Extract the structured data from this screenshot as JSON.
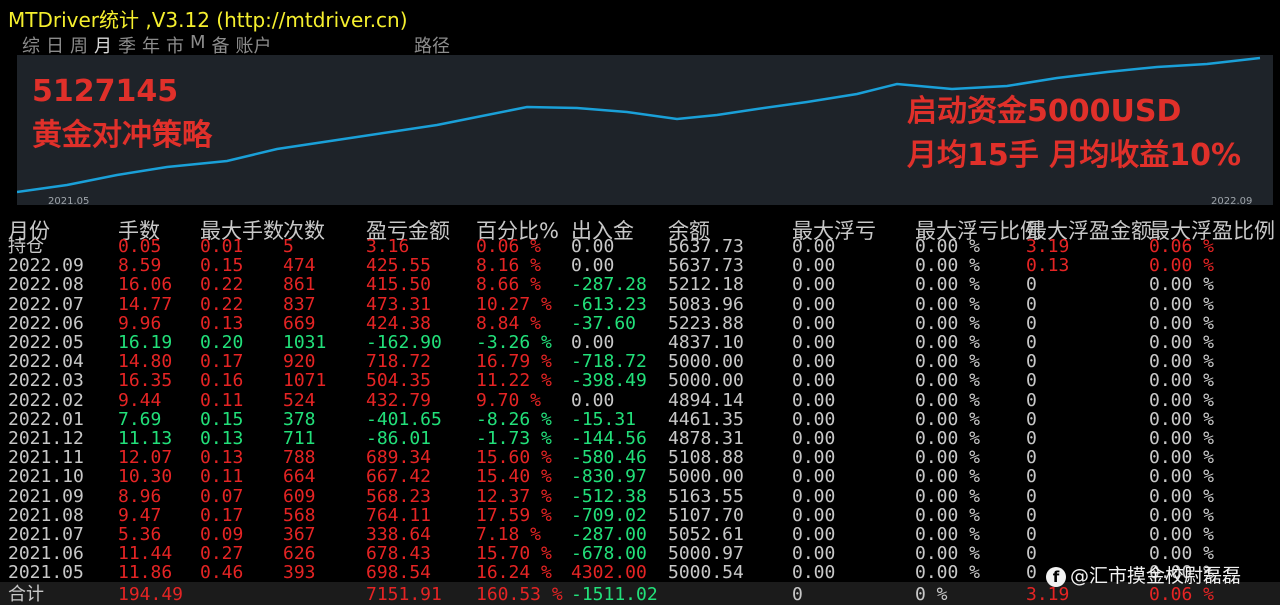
{
  "title": "MTDriver统计 ,V3.12 (http://mtdriver.cn)",
  "tabs": [
    "综",
    "日",
    "周",
    "月",
    "季",
    "年",
    "市",
    "M",
    "备",
    "账户"
  ],
  "active_tab": "月",
  "path_label": "路径",
  "chart": {
    "x_start": "2021.05",
    "x_end": "2022.09",
    "line_color": "#1aa0d8",
    "overlay_left": [
      "5127145",
      "黄金对冲策略"
    ],
    "overlay_right": [
      "启动资金5000USD",
      "月均15手  月均收益10%"
    ]
  },
  "headers": [
    "月份",
    "手数",
    "最大手数",
    "次数",
    "盈亏金额",
    "百分比%",
    "出入金",
    "余额",
    "最大浮亏",
    "最大浮亏比例",
    "最大浮盈金额",
    "最大浮盈比例"
  ],
  "rows": [
    [
      "持仓",
      "0.05",
      "0.01",
      "5",
      "3.16",
      "0.06 %",
      "0.00",
      "5637.73",
      "0.00",
      "0.00 %",
      "3.19",
      "0.06 %"
    ],
    [
      "2022.09",
      "8.59",
      "0.15",
      "474",
      "425.55",
      "8.16 %",
      "0.00",
      "5637.73",
      "0.00",
      "0.00 %",
      "0.13",
      "0.00 %"
    ],
    [
      "2022.08",
      "16.06",
      "0.22",
      "861",
      "415.50",
      "8.66 %",
      "-287.28",
      "5212.18",
      "0.00",
      "0.00 %",
      "0",
      "0.00 %"
    ],
    [
      "2022.07",
      "14.77",
      "0.22",
      "837",
      "473.31",
      "10.27 %",
      "-613.23",
      "5083.96",
      "0.00",
      "0.00 %",
      "0",
      "0.00 %"
    ],
    [
      "2022.06",
      "9.96",
      "0.13",
      "669",
      "424.38",
      "8.84 %",
      "-37.60",
      "5223.88",
      "0.00",
      "0.00 %",
      "0",
      "0.00 %"
    ],
    [
      "2022.05",
      "16.19",
      "0.20",
      "1031",
      "-162.90",
      "-3.26 %",
      "0.00",
      "4837.10",
      "0.00",
      "0.00 %",
      "0",
      "0.00 %"
    ],
    [
      "2022.04",
      "14.80",
      "0.17",
      "920",
      "718.72",
      "16.79 %",
      "-718.72",
      "5000.00",
      "0.00",
      "0.00 %",
      "0",
      "0.00 %"
    ],
    [
      "2022.03",
      "16.35",
      "0.16",
      "1071",
      "504.35",
      "11.22 %",
      "-398.49",
      "5000.00",
      "0.00",
      "0.00 %",
      "0",
      "0.00 %"
    ],
    [
      "2022.02",
      "9.44",
      "0.11",
      "524",
      "432.79",
      "9.70 %",
      "0.00",
      "4894.14",
      "0.00",
      "0.00 %",
      "0",
      "0.00 %"
    ],
    [
      "2022.01",
      "7.69",
      "0.15",
      "378",
      "-401.65",
      "-8.26 %",
      "-15.31",
      "4461.35",
      "0.00",
      "0.00 %",
      "0",
      "0.00 %"
    ],
    [
      "2021.12",
      "11.13",
      "0.13",
      "711",
      "-86.01",
      "-1.73 %",
      "-144.56",
      "4878.31",
      "0.00",
      "0.00 %",
      "0",
      "0.00 %"
    ],
    [
      "2021.11",
      "12.07",
      "0.13",
      "788",
      "689.34",
      "15.60 %",
      "-580.46",
      "5108.88",
      "0.00",
      "0.00 %",
      "0",
      "0.00 %"
    ],
    [
      "2021.10",
      "10.30",
      "0.11",
      "664",
      "667.42",
      "15.40 %",
      "-830.97",
      "5000.00",
      "0.00",
      "0.00 %",
      "0",
      "0.00 %"
    ],
    [
      "2021.09",
      "8.96",
      "0.07",
      "609",
      "568.23",
      "12.37 %",
      "-512.38",
      "5163.55",
      "0.00",
      "0.00 %",
      "0",
      "0.00 %"
    ],
    [
      "2021.08",
      "9.47",
      "0.17",
      "568",
      "764.11",
      "17.59 %",
      "-709.02",
      "5107.70",
      "0.00",
      "0.00 %",
      "0",
      "0.00 %"
    ],
    [
      "2021.07",
      "5.36",
      "0.09",
      "367",
      "338.64",
      "7.18 %",
      "-287.00",
      "5052.61",
      "0.00",
      "0.00 %",
      "0",
      "0.00 %"
    ],
    [
      "2021.06",
      "11.44",
      "0.27",
      "626",
      "678.43",
      "15.70 %",
      "-678.00",
      "5000.97",
      "0.00",
      "0.00 %",
      "0",
      "0.00 %"
    ],
    [
      "2021.05",
      "11.86",
      "0.46",
      "393",
      "698.54",
      "16.24 %",
      "4302.00",
      "5000.54",
      "0.00",
      "0.00 %",
      "0",
      "0.00 %"
    ]
  ],
  "totals": [
    "合计",
    "194.49",
    "",
    "",
    "7151.91",
    "160.53 %",
    "-1511.02",
    "",
    "0",
    "0 %",
    "3.19",
    "0.06 %"
  ],
  "watermark": "@汇市摸金校尉磊磊",
  "colors": {
    "profit": "#e52424",
    "loss": "#22e07a",
    "neutral": "#c8c8c8",
    "title": "#f5ef2e",
    "overlay": "#e0302a"
  }
}
